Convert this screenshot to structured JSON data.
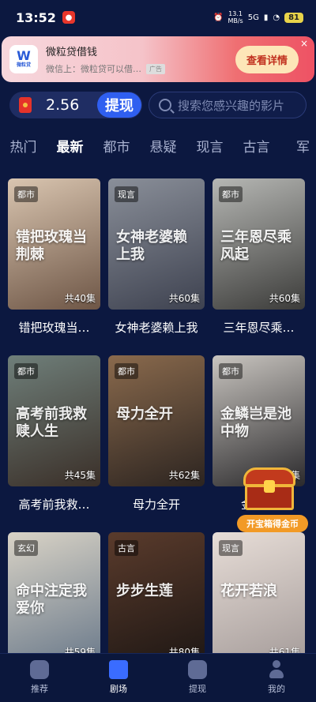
{
  "status_bar": {
    "time": "13:52",
    "net_speed": "13.1",
    "net_unit": "MB/s",
    "signal": "5G",
    "battery": "81"
  },
  "ad": {
    "logo_text": "W",
    "logo_sub": "微粒贷",
    "title": "微粒贷借钱",
    "subtitle": "微信上：微粒贷可以借…",
    "tag": "广告",
    "cta": "查看详情",
    "close": "×"
  },
  "wallet": {
    "value": "2.56",
    "withdraw_label": "提现"
  },
  "search": {
    "placeholder": "搜索您感兴趣的影片"
  },
  "tabs": [
    {
      "label": "热门"
    },
    {
      "label": "最新"
    },
    {
      "label": "都市"
    },
    {
      "label": "悬疑"
    },
    {
      "label": "现言"
    },
    {
      "label": "古言"
    },
    {
      "label": "军"
    }
  ],
  "active_tab": "最新",
  "dramas": [
    {
      "title": "错把玫瑰当…",
      "tag": "都市",
      "episodes": "共40集",
      "poster_text": "错把玫瑰当荆棘",
      "colors": [
        "#d9c5b0",
        "#6e5646"
      ]
    },
    {
      "title": "女神老婆赖上我",
      "tag": "现言",
      "episodes": "共60集",
      "poster_text": "女神老婆赖上我",
      "colors": [
        "#8a8f99",
        "#3e4250"
      ]
    },
    {
      "title": "三年恩尽乘…",
      "tag": "都市",
      "episodes": "共60集",
      "poster_text": "三年恩尽乘风起",
      "colors": [
        "#b6b7b4",
        "#3c3c3a"
      ]
    },
    {
      "title": "高考前我救…",
      "tag": "都市",
      "episodes": "共45集",
      "poster_text": "高考前我救赎人生",
      "colors": [
        "#6f7f7a",
        "#3a2f28"
      ]
    },
    {
      "title": "母力全开",
      "tag": "都市",
      "episodes": "共62集",
      "poster_text": "母力全开",
      "colors": [
        "#8a6a4d",
        "#2c2420"
      ]
    },
    {
      "title": "金麟…",
      "tag": "都市",
      "episodes": "共…集",
      "poster_text": "金鳞岂是池中物",
      "colors": [
        "#c9c5c0",
        "#2b2a2c"
      ]
    },
    {
      "title": "",
      "tag": "玄幻",
      "episodes": "共59集",
      "poster_text": "命中注定我爱你",
      "colors": [
        "#d9d3c6",
        "#6b7a8b"
      ]
    },
    {
      "title": "",
      "tag": "古言",
      "episodes": "共80集",
      "poster_text": "步步生莲",
      "colors": [
        "#5a3b2c",
        "#1e1714"
      ]
    },
    {
      "title": "",
      "tag": "现言",
      "episodes": "共61集",
      "poster_text": "花开若浪",
      "colors": [
        "#e7ddd7",
        "#a59c9a"
      ]
    }
  ],
  "treasure": {
    "label": "开宝箱得金币"
  },
  "bottom_nav": [
    {
      "label": "推荐",
      "icon": "home-icon"
    },
    {
      "label": "剧场",
      "icon": "theater-icon"
    },
    {
      "label": "提现",
      "icon": "chat-icon"
    },
    {
      "label": "我的",
      "icon": "user-icon"
    }
  ],
  "active_nav": "剧场"
}
